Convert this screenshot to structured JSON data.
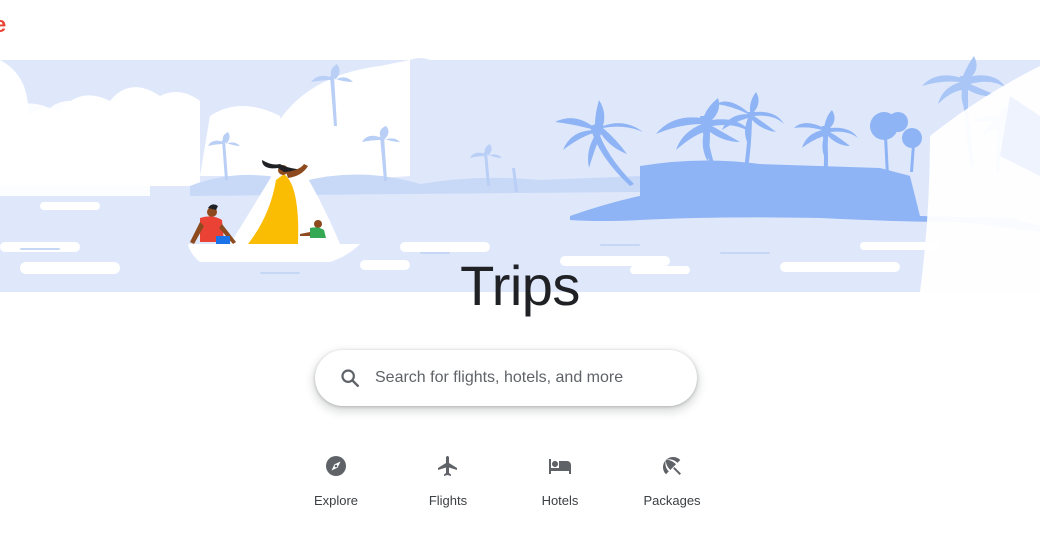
{
  "header": {
    "logo_fragment": "e"
  },
  "hero": {
    "illustration": "tropical-island-sailing-illustration"
  },
  "page": {
    "title": "Trips"
  },
  "search": {
    "placeholder": "Search for flights, hotels, and more",
    "icon": "search-icon"
  },
  "categories": [
    {
      "label": "Explore",
      "icon": "compass-icon"
    },
    {
      "label": "Flights",
      "icon": "airplane-icon"
    },
    {
      "label": "Hotels",
      "icon": "bed-icon"
    },
    {
      "label": "Packages",
      "icon": "beach-umbrella-icon"
    }
  ],
  "colors": {
    "sky": "#dfe8fb",
    "cloud": "#ffffff",
    "island": "#8fb4f5",
    "palm_light": "#a9c6f7",
    "icon": "#5f6368",
    "title": "#202124",
    "logo": "#ea4335"
  }
}
